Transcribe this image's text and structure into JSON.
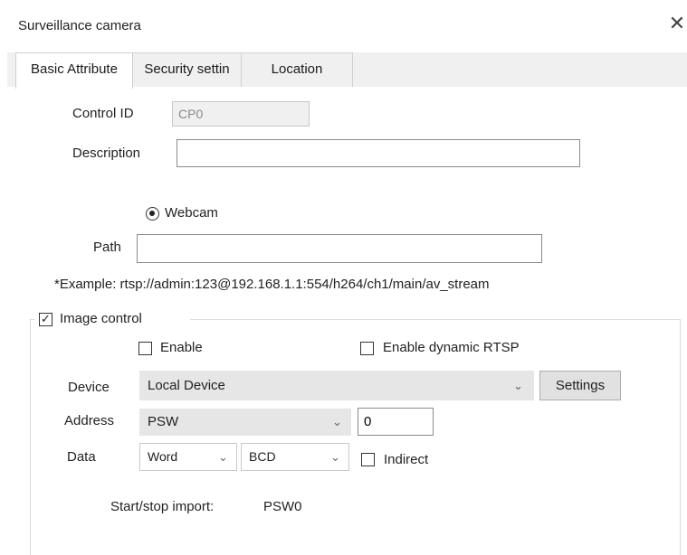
{
  "window": {
    "title": "Surveillance camera",
    "close_glyph": "✕"
  },
  "tabs": [
    {
      "label": "Basic Attribute"
    },
    {
      "label": "Security settin"
    },
    {
      "label": "Location"
    }
  ],
  "basic": {
    "control_id_label": "Control ID",
    "control_id_value": "CP0",
    "description_label": "Description",
    "description_value": "",
    "webcam_label": "Webcam",
    "path_label": "Path",
    "path_value": "",
    "example_text": "*Example: rtsp://admin:123@192.168.1.1:554/h264/ch1/main/av_stream"
  },
  "image_control": {
    "label": "Image control",
    "checked_glyph": "✓",
    "enable_label": "Enable",
    "enable_dynamic_rtsp_label": "Enable dynamic RTSP",
    "device_label": "Device",
    "device_value": "Local Device",
    "settings_label": "Settings",
    "address_label": "Address",
    "address_type": "PSW",
    "address_value": "0",
    "data_label": "Data",
    "data_type": "Word",
    "data_format": "BCD",
    "indirect_label": "Indirect",
    "start_stop_label": "Start/stop import:",
    "start_stop_value": "PSW0"
  },
  "icons": {
    "dropdown": "chevron-down-icon",
    "close": "close-icon"
  }
}
